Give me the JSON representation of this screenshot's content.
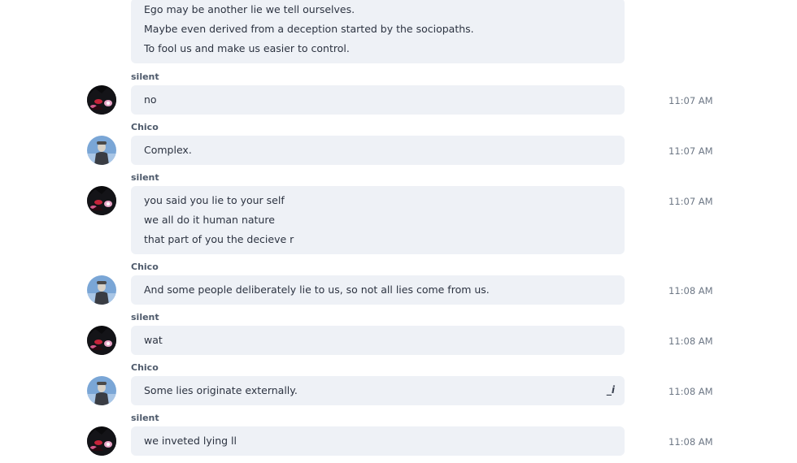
{
  "messages": [
    {
      "sender": "",
      "lines": [
        "Ego may be another lie we tell ourselves.",
        "Maybe even derived from a deception started by the sociopaths.",
        "To fool us and make us easier to control."
      ],
      "time": ""
    },
    {
      "sender": "silent",
      "lines": [
        "no"
      ],
      "time": "11:07 AM"
    },
    {
      "sender": "Chico",
      "lines": [
        "Complex."
      ],
      "time": "11:07 AM"
    },
    {
      "sender": "silent",
      "lines": [
        "you said you lie to your self",
        "we all do it human nature",
        "that part of you the decieve r"
      ],
      "time": "11:07 AM"
    },
    {
      "sender": "Chico",
      "lines": [
        "And some people deliberately lie to us, so not all lies come from us."
      ],
      "time": "11:08 AM"
    },
    {
      "sender": "silent",
      "lines": [
        "wat"
      ],
      "time": "11:08 AM"
    },
    {
      "sender": "Chico",
      "lines": [
        "Some lies originate externally."
      ],
      "time": "11:08 AM",
      "edit_icon": "_i"
    },
    {
      "sender": "silent",
      "lines": [
        "we inveted lying ll"
      ],
      "time": "11:08 AM"
    }
  ],
  "icons": {
    "silent_avatar": "anime-avatar-icon",
    "chico_avatar": "person-avatar-icon",
    "edit": "edit-cursor-icon"
  },
  "colors": {
    "bubble_bg": "#eef1f6",
    "text": "#2c3341",
    "sender": "#4e5a6b",
    "time": "#6e7886"
  }
}
